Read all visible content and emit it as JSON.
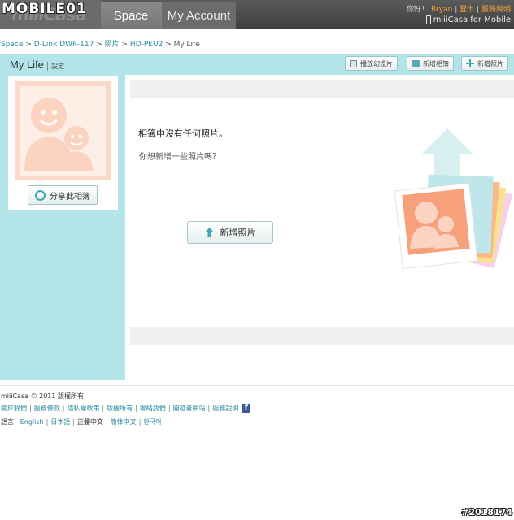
{
  "watermark_top": "MOBILE01",
  "watermark_bottom": "#2018174",
  "logo": "miiiCasa",
  "nav": {
    "tab_space": "Space",
    "tab_account": "My Account"
  },
  "user": {
    "greeting": "你好！",
    "name": "Bryan",
    "logout": "登出",
    "help": "服務說明",
    "mobile": "miiiCasa for Mobile"
  },
  "breadcrumb": {
    "items": [
      "Space",
      "D-Link DWR-117",
      "照片",
      "HD-PEU2"
    ],
    "current": "My Life"
  },
  "album": {
    "title": "My Life",
    "settings": "設定",
    "buttons": {
      "slideshow": "播放幻燈片",
      "new_album": "新增相簿",
      "new_photo": "新增照片"
    },
    "share_button": "分享此相簿"
  },
  "main": {
    "empty_title": "相簿中沒有任何照片。",
    "empty_sub": "你想新增一些照片嗎？",
    "add_photo_button": "新增照片"
  },
  "footer": {
    "copyright": "miiiCasa © 2011  版權所有",
    "links": [
      "關於我們",
      "服務條款",
      "隱私權政策",
      "版權所有",
      "聯絡我們",
      "開發者網站",
      "服務說明"
    ],
    "lang_label": "語言:",
    "languages": [
      "English",
      "日本語",
      "正體中文",
      "簡体中文",
      "한국어"
    ],
    "active_language": "正體中文"
  },
  "colors": {
    "accent_teal": "#b3e4e7",
    "link": "#2a8aa0",
    "user_link": "#f2a33a",
    "topbar": "#4a4a4a"
  }
}
